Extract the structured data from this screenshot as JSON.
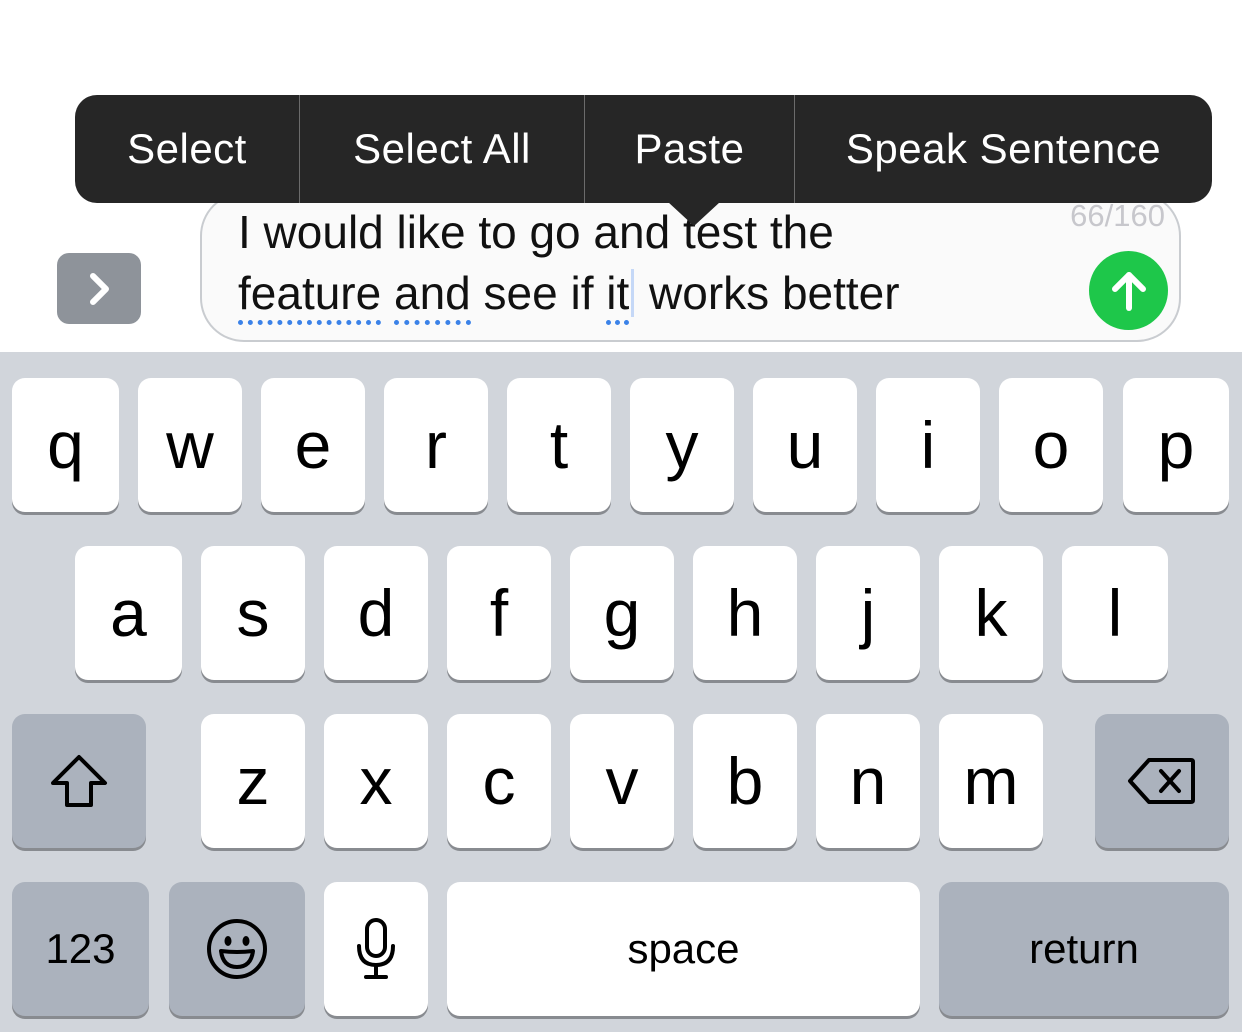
{
  "edit_menu": {
    "items": [
      "Select",
      "Select All",
      "Paste",
      "Speak Sentence"
    ]
  },
  "input": {
    "text_line_1": "I would like to go and test the",
    "text_line_2": {
      "misspelled_1": "feature",
      "space_1": " ",
      "misspelled_2": "and",
      "middle": " see if ",
      "misspelled_3": "it",
      "end": " works better"
    },
    "char_counter": "66/160"
  },
  "keyboard": {
    "row1": [
      "q",
      "w",
      "e",
      "r",
      "t",
      "y",
      "u",
      "i",
      "o",
      "p"
    ],
    "row2": [
      "a",
      "s",
      "d",
      "f",
      "g",
      "h",
      "j",
      "k",
      "l"
    ],
    "row3": [
      "z",
      "x",
      "c",
      "v",
      "b",
      "n",
      "m"
    ],
    "numbers_label": "123",
    "space_label": "space",
    "return_label": "return"
  },
  "icons": {
    "expand": "chevron-right-icon",
    "send": "arrow-up-icon",
    "shift": "shift-arrow-icon",
    "delete": "backspace-icon",
    "emoji": "smiley-face-icon",
    "dictation": "microphone-icon"
  },
  "colors": {
    "menu_background": "#262626",
    "send_button": "#1ec74a",
    "keyboard_background": "#d1d5db",
    "function_keys": "#abb2bd",
    "spell_underline": "#3b82e8",
    "expand_button": "#8e939a"
  }
}
